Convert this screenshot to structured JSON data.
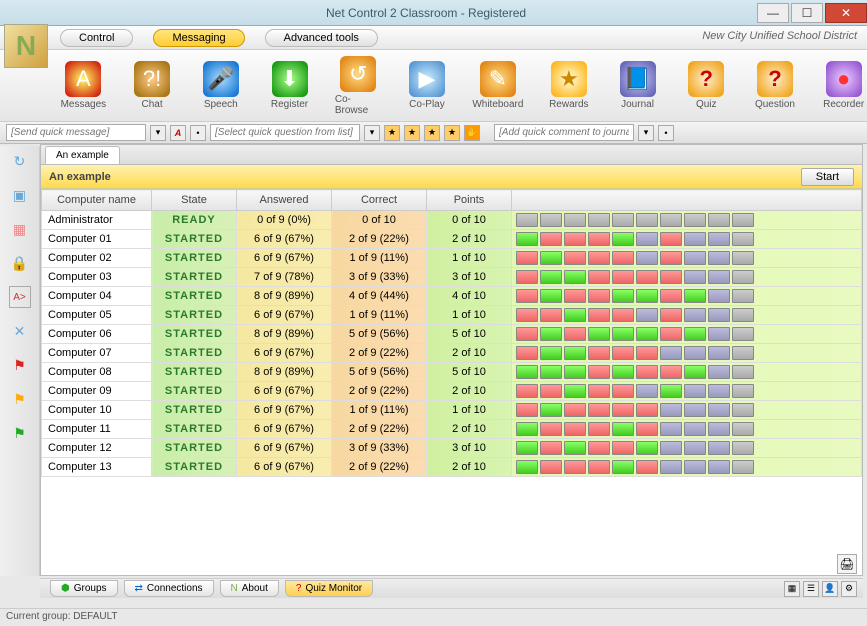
{
  "window": {
    "title": "Net Control 2 Classroom - Registered"
  },
  "brand": "New City Unified School District",
  "topTabs": {
    "control": "Control",
    "messaging": "Messaging",
    "advanced": "Advanced tools"
  },
  "toolbar": [
    {
      "label": "Messages",
      "icon": "A"
    },
    {
      "label": "Chat",
      "icon": "?!"
    },
    {
      "label": "Speech",
      "icon": "🎤"
    },
    {
      "label": "Register",
      "icon": "⬇"
    },
    {
      "label": "Co-Browse",
      "icon": "↺"
    },
    {
      "label": "Co-Play",
      "icon": "▶"
    },
    {
      "label": "Whiteboard",
      "icon": "✎"
    },
    {
      "label": "Rewards",
      "icon": "★"
    },
    {
      "label": "Journal",
      "icon": "📘"
    },
    {
      "label": "Quiz",
      "icon": "?"
    },
    {
      "label": "Question",
      "icon": "?"
    },
    {
      "label": "Recorder",
      "icon": "●"
    }
  ],
  "toolClasses": [
    "ic-red",
    "ic-brown",
    "ic-blue",
    "ic-green",
    "ic-orange",
    "ic-play",
    "ic-orange",
    "ic-star",
    "ic-book",
    "ic-q",
    "ic-q",
    "ic-rec"
  ],
  "quick": {
    "msg": "[Send quick message]",
    "question": "[Select quick question from list]",
    "journal": "[Add quick comment to journal]"
  },
  "docTab": "An example",
  "panelTitle": "An example",
  "startLabel": "Start",
  "headers": {
    "name": "Computer name",
    "state": "State",
    "answered": "Answered",
    "correct": "Correct",
    "points": "Points"
  },
  "rows": [
    {
      "name": "Administrator",
      "state": "READY",
      "answered": "0 of 9 (0%)",
      "correct": "0 of 10",
      "points": "0 of 10",
      "cells": [
        "gray",
        "gray",
        "gray",
        "gray",
        "gray",
        "gray",
        "gray",
        "gray",
        "gray",
        "gray"
      ]
    },
    {
      "name": "Computer 01",
      "state": "STARTED",
      "answered": "6 of 9 (67%)",
      "correct": "2 of 9 (22%)",
      "points": "2 of 10",
      "cells": [
        "green",
        "red",
        "red",
        "red",
        "green",
        "purple",
        "red",
        "purple",
        "purple",
        "gray"
      ]
    },
    {
      "name": "Computer 02",
      "state": "STARTED",
      "answered": "6 of 9 (67%)",
      "correct": "1 of 9 (11%)",
      "points": "1 of 10",
      "cells": [
        "red",
        "green",
        "red",
        "red",
        "red",
        "purple",
        "red",
        "purple",
        "purple",
        "gray"
      ]
    },
    {
      "name": "Computer 03",
      "state": "STARTED",
      "answered": "7 of 9 (78%)",
      "correct": "3 of 9 (33%)",
      "points": "3 of 10",
      "cells": [
        "red",
        "green",
        "green",
        "red",
        "red",
        "red",
        "red",
        "purple",
        "purple",
        "gray"
      ]
    },
    {
      "name": "Computer 04",
      "state": "STARTED",
      "answered": "8 of 9 (89%)",
      "correct": "4 of 9 (44%)",
      "points": "4 of 10",
      "cells": [
        "red",
        "green",
        "red",
        "red",
        "green",
        "green",
        "red",
        "green",
        "purple",
        "gray"
      ]
    },
    {
      "name": "Computer 05",
      "state": "STARTED",
      "answered": "6 of 9 (67%)",
      "correct": "1 of 9 (11%)",
      "points": "1 of 10",
      "cells": [
        "red",
        "red",
        "green",
        "red",
        "red",
        "purple",
        "red",
        "purple",
        "purple",
        "gray"
      ]
    },
    {
      "name": "Computer 06",
      "state": "STARTED",
      "answered": "8 of 9 (89%)",
      "correct": "5 of 9 (56%)",
      "points": "5 of 10",
      "cells": [
        "red",
        "green",
        "red",
        "green",
        "green",
        "green",
        "red",
        "green",
        "purple",
        "gray"
      ]
    },
    {
      "name": "Computer 07",
      "state": "STARTED",
      "answered": "6 of 9 (67%)",
      "correct": "2 of 9 (22%)",
      "points": "2 of 10",
      "cells": [
        "red",
        "green",
        "green",
        "red",
        "red",
        "red",
        "purple",
        "purple",
        "purple",
        "gray"
      ]
    },
    {
      "name": "Computer 08",
      "state": "STARTED",
      "answered": "8 of 9 (89%)",
      "correct": "5 of 9 (56%)",
      "points": "5 of 10",
      "cells": [
        "green",
        "green",
        "green",
        "red",
        "green",
        "red",
        "red",
        "green",
        "purple",
        "gray"
      ]
    },
    {
      "name": "Computer 09",
      "state": "STARTED",
      "answered": "6 of 9 (67%)",
      "correct": "2 of 9 (22%)",
      "points": "2 of 10",
      "cells": [
        "red",
        "red",
        "green",
        "red",
        "red",
        "purple",
        "green",
        "purple",
        "purple",
        "gray"
      ]
    },
    {
      "name": "Computer 10",
      "state": "STARTED",
      "answered": "6 of 9 (67%)",
      "correct": "1 of 9 (11%)",
      "points": "1 of 10",
      "cells": [
        "red",
        "green",
        "red",
        "red",
        "red",
        "red",
        "purple",
        "purple",
        "purple",
        "gray"
      ]
    },
    {
      "name": "Computer 11",
      "state": "STARTED",
      "answered": "6 of 9 (67%)",
      "correct": "2 of 9 (22%)",
      "points": "2 of 10",
      "cells": [
        "green",
        "red",
        "red",
        "red",
        "green",
        "red",
        "purple",
        "purple",
        "purple",
        "gray"
      ]
    },
    {
      "name": "Computer 12",
      "state": "STARTED",
      "answered": "6 of 9 (67%)",
      "correct": "3 of 9 (33%)",
      "points": "3 of 10",
      "cells": [
        "green",
        "red",
        "green",
        "red",
        "red",
        "green",
        "purple",
        "purple",
        "purple",
        "gray"
      ]
    },
    {
      "name": "Computer 13",
      "state": "STARTED",
      "answered": "6 of 9 (67%)",
      "correct": "2 of 9 (22%)",
      "points": "2 of 10",
      "cells": [
        "green",
        "red",
        "red",
        "red",
        "green",
        "red",
        "purple",
        "purple",
        "purple",
        "gray"
      ]
    }
  ],
  "bottomTabs": {
    "groups": "Groups",
    "connections": "Connections",
    "about": "About",
    "quiz": "Quiz Monitor"
  },
  "status": "Current group: DEFAULT"
}
